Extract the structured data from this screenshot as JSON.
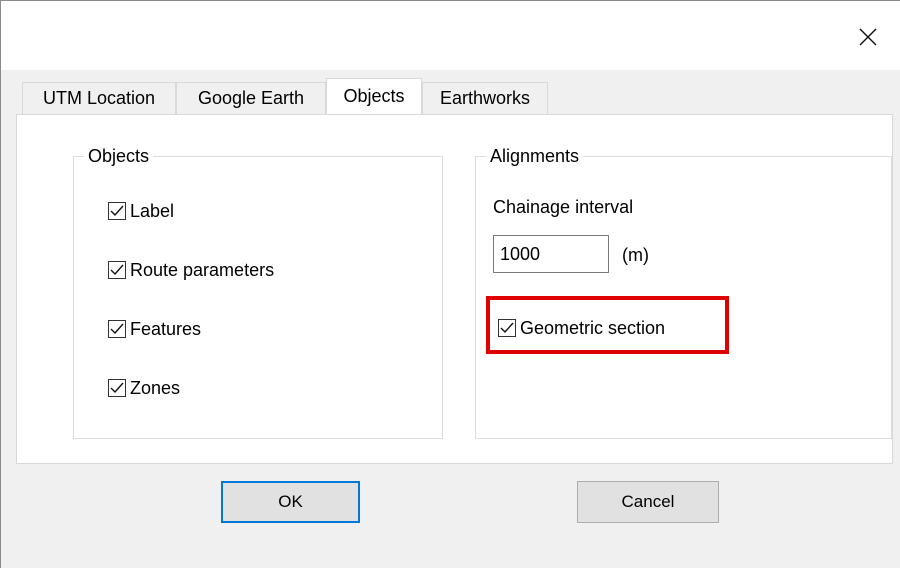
{
  "window": {
    "close_icon": "close-icon"
  },
  "tabs": [
    {
      "label": "UTM Location",
      "active": false
    },
    {
      "label": "Google Earth",
      "active": false
    },
    {
      "label": "Objects",
      "active": true
    },
    {
      "label": "Earthworks",
      "active": false
    }
  ],
  "objects_group": {
    "title": "Objects",
    "items": [
      {
        "label": "Label",
        "checked": true
      },
      {
        "label": "Route parameters",
        "checked": true
      },
      {
        "label": "Features",
        "checked": true
      },
      {
        "label": "Zones",
        "checked": true
      }
    ]
  },
  "alignments_group": {
    "title": "Alignments",
    "chainage_label": "Chainage interval",
    "chainage_value": "1000",
    "chainage_unit": "(m)",
    "geometric_section_label": "Geometric section",
    "geometric_section_checked": true
  },
  "buttons": {
    "ok_label": "OK",
    "cancel_label": "Cancel"
  },
  "colors": {
    "highlight": "#e00000",
    "default_button_border": "#0078d7"
  }
}
